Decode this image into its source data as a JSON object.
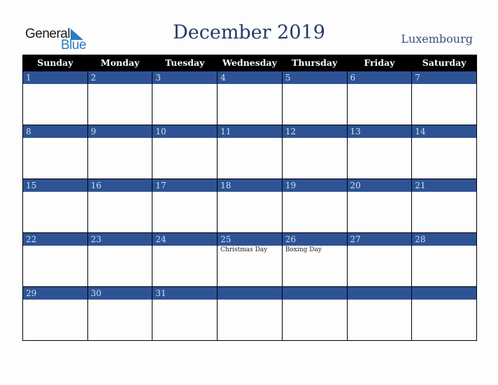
{
  "logo": {
    "general": "General",
    "blue": "Blue"
  },
  "title": "December 2019",
  "country": "Luxembourg",
  "colors": {
    "header_bg": "#000000",
    "day_bar": "#2e5395",
    "title": "#243b66",
    "logo_blue": "#2a7bc4"
  },
  "weekdays": [
    "Sunday",
    "Monday",
    "Tuesday",
    "Wednesday",
    "Thursday",
    "Friday",
    "Saturday"
  ],
  "weeks": [
    [
      {
        "day": "1",
        "event": ""
      },
      {
        "day": "2",
        "event": ""
      },
      {
        "day": "3",
        "event": ""
      },
      {
        "day": "4",
        "event": ""
      },
      {
        "day": "5",
        "event": ""
      },
      {
        "day": "6",
        "event": ""
      },
      {
        "day": "7",
        "event": ""
      }
    ],
    [
      {
        "day": "8",
        "event": ""
      },
      {
        "day": "9",
        "event": ""
      },
      {
        "day": "10",
        "event": ""
      },
      {
        "day": "11",
        "event": ""
      },
      {
        "day": "12",
        "event": ""
      },
      {
        "day": "13",
        "event": ""
      },
      {
        "day": "14",
        "event": ""
      }
    ],
    [
      {
        "day": "15",
        "event": ""
      },
      {
        "day": "16",
        "event": ""
      },
      {
        "day": "17",
        "event": ""
      },
      {
        "day": "18",
        "event": ""
      },
      {
        "day": "19",
        "event": ""
      },
      {
        "day": "20",
        "event": ""
      },
      {
        "day": "21",
        "event": ""
      }
    ],
    [
      {
        "day": "22",
        "event": ""
      },
      {
        "day": "23",
        "event": ""
      },
      {
        "day": "24",
        "event": ""
      },
      {
        "day": "25",
        "event": "Christmas Day"
      },
      {
        "day": "26",
        "event": "Boxing Day"
      },
      {
        "day": "27",
        "event": ""
      },
      {
        "day": "28",
        "event": ""
      }
    ],
    [
      {
        "day": "29",
        "event": ""
      },
      {
        "day": "30",
        "event": ""
      },
      {
        "day": "31",
        "event": ""
      },
      {
        "day": "",
        "event": ""
      },
      {
        "day": "",
        "event": ""
      },
      {
        "day": "",
        "event": ""
      },
      {
        "day": "",
        "event": ""
      }
    ]
  ]
}
